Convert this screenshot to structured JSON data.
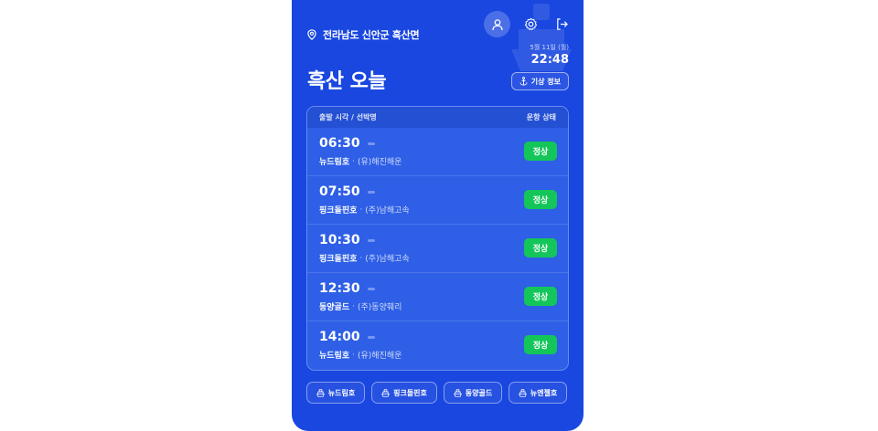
{
  "location": {
    "text": "전라남도 신안군 흑산면",
    "icon": "map-pin-icon"
  },
  "header_icons": [
    {
      "name": "user-icon"
    },
    {
      "name": "gear-icon"
    },
    {
      "name": "logout-icon"
    }
  ],
  "date": "5월 11일 (월)",
  "clock": "22:48",
  "title": "흑산 오늘",
  "weather_button": {
    "label": "기상 정보",
    "icon": "anchor-icon"
  },
  "table": {
    "header_left": "출발 시각 / 선박명",
    "header_right": "운항 상태",
    "rows": [
      {
        "time": "06:30",
        "ship": "뉴드림호",
        "company": "(유)해진해운",
        "status": "정상"
      },
      {
        "time": "07:50",
        "ship": "핑크돌핀호",
        "company": "(주)남해고속",
        "status": "정상"
      },
      {
        "time": "10:30",
        "ship": "핑크돌핀호",
        "company": "(주)남해고속",
        "status": "정상"
      },
      {
        "time": "12:30",
        "ship": "동양골드",
        "company": "(주)동양훼리",
        "status": "정상"
      },
      {
        "time": "14:00",
        "ship": "뉴드림호",
        "company": "(유)해진해운",
        "status": "정상"
      }
    ]
  },
  "ship_chips": [
    {
      "label": "뉴드림호"
    },
    {
      "label": "핑크돌핀호"
    },
    {
      "label": "동양골드"
    },
    {
      "label": "뉴엔젤호"
    }
  ],
  "colors": {
    "background": "#1947e0",
    "card": "#2e5fe6",
    "status_ok": "#14c65a"
  }
}
